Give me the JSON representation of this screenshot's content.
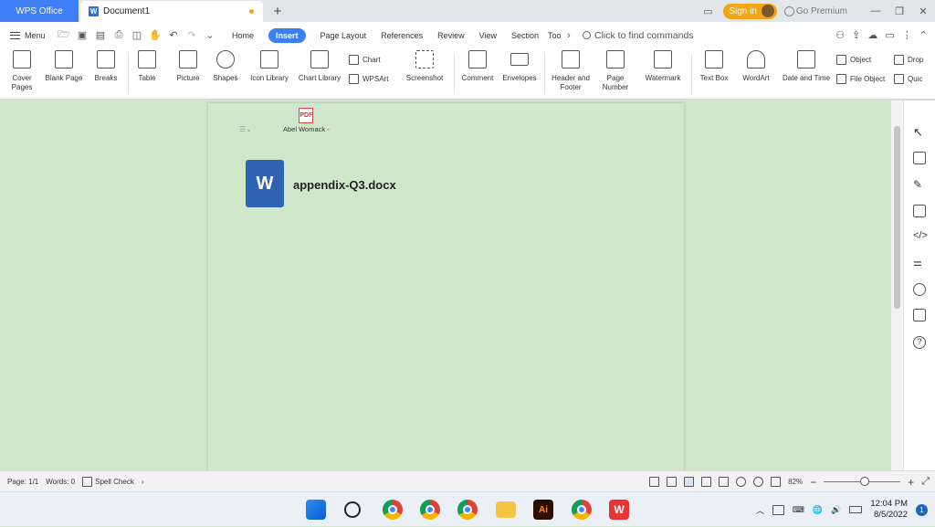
{
  "titlebar": {
    "app_tab": "WPS Office",
    "doc_tab": "Document1",
    "new_tab": "+",
    "sign_in": "Sign in",
    "go_premium": "Go Premium"
  },
  "menurow": {
    "menu_label": "Menu",
    "tabs": [
      "Home",
      "Insert",
      "Page Layout",
      "References",
      "Review",
      "View",
      "Section",
      "Too"
    ],
    "active_tab": "Insert",
    "search_placeholder": "Click to find commands"
  },
  "ribbon": {
    "items": [
      {
        "label": "Cover Pages",
        "icon": "cover-pages-icon"
      },
      {
        "label": "Blank Page",
        "icon": "blank-page-icon"
      },
      {
        "label": "Breaks",
        "icon": "breaks-icon"
      },
      {
        "label": "Table",
        "icon": "table-icon"
      },
      {
        "label": "Picture",
        "icon": "picture-icon"
      },
      {
        "label": "Shapes",
        "icon": "shapes-icon"
      },
      {
        "label": "Icon Library",
        "icon": "icon-library-icon"
      },
      {
        "label": "Chart Library",
        "icon": "chart-library-icon"
      },
      {
        "label": "Screenshot",
        "icon": "screenshot-icon"
      },
      {
        "label": "Comment",
        "icon": "comment-icon"
      },
      {
        "label": "Envelopes",
        "icon": "envelopes-icon"
      },
      {
        "label": "Header and Footer",
        "icon": "header-footer-icon"
      },
      {
        "label": "Page Number",
        "icon": "page-number-icon"
      },
      {
        "label": "Watermark",
        "icon": "watermark-icon"
      },
      {
        "label": "Text Box",
        "icon": "text-box-icon"
      },
      {
        "label": "WordArt",
        "icon": "wordart-icon"
      },
      {
        "label": "Date and Time",
        "icon": "date-time-icon"
      }
    ],
    "small": {
      "chart": "Chart",
      "wpsart": "WPSArt",
      "object": "Object",
      "file_object": "File Object",
      "drop": "Drop",
      "quick": "Quic"
    }
  },
  "document": {
    "pdf_attachment_name": "Abel Womack -",
    "embedded_file_name": "appendix-Q3.docx",
    "word_icon_letter": "W"
  },
  "statusbar": {
    "page": "Page: 1/1",
    "words": "Words: 0",
    "spell_check": "Spell Check",
    "zoom": "82%"
  },
  "taskbar": {
    "time": "12:04 PM",
    "date": "8/5/2022",
    "notifications": "1",
    "apps": [
      "start",
      "search",
      "chrome",
      "chrome",
      "chrome",
      "file-explorer",
      "illustrator",
      "chrome",
      "wps-office"
    ]
  }
}
